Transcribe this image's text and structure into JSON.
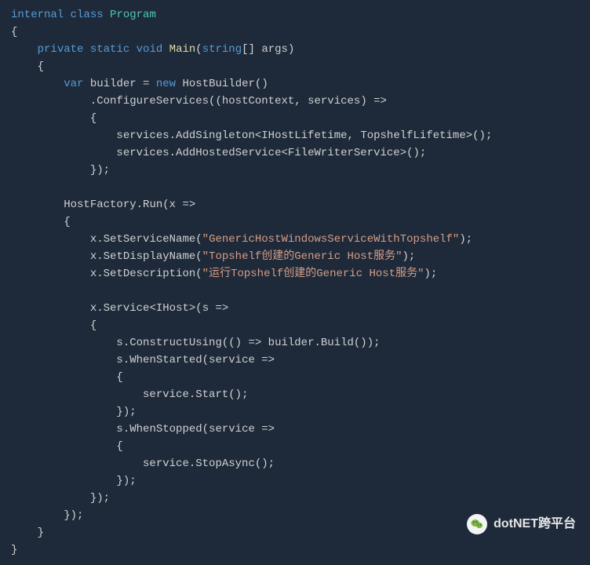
{
  "watermark": {
    "text": "dotNET跨平台"
  },
  "code": {
    "tokens": [
      [
        [
          "kw1",
          "internal"
        ],
        [
          "punc",
          " "
        ],
        [
          "kw1",
          "class"
        ],
        [
          "punc",
          " "
        ],
        [
          "kw2",
          "Program"
        ]
      ],
      [
        [
          "punc",
          "{"
        ]
      ],
      [
        [
          "punc",
          "    "
        ],
        [
          "kw1",
          "private"
        ],
        [
          "punc",
          " "
        ],
        [
          "kw1",
          "static"
        ],
        [
          "punc",
          " "
        ],
        [
          "kw1",
          "void"
        ],
        [
          "punc",
          " "
        ],
        [
          "mname",
          "Main"
        ],
        [
          "punc",
          "("
        ],
        [
          "kw1",
          "string"
        ],
        [
          "punc",
          "[] "
        ],
        [
          "ident",
          "args"
        ],
        [
          "punc",
          ")"
        ]
      ],
      [
        [
          "punc",
          "    {"
        ]
      ],
      [
        [
          "punc",
          "        "
        ],
        [
          "kw1",
          "var"
        ],
        [
          "punc",
          " "
        ],
        [
          "ident",
          "builder"
        ],
        [
          "punc",
          " = "
        ],
        [
          "kw1",
          "new"
        ],
        [
          "punc",
          " "
        ],
        [
          "ident",
          "HostBuilder"
        ],
        [
          "punc",
          "()"
        ]
      ],
      [
        [
          "punc",
          "            ."
        ],
        [
          "ident",
          "ConfigureServices"
        ],
        [
          "punc",
          "(("
        ],
        [
          "ident",
          "hostContext"
        ],
        [
          "punc",
          ", "
        ],
        [
          "ident",
          "services"
        ],
        [
          "punc",
          ") =>"
        ]
      ],
      [
        [
          "punc",
          "            {"
        ]
      ],
      [
        [
          "punc",
          "                "
        ],
        [
          "ident",
          "services"
        ],
        [
          "punc",
          "."
        ],
        [
          "ident",
          "AddSingleton"
        ],
        [
          "punc",
          "<"
        ],
        [
          "ident",
          "IHostLifetime"
        ],
        [
          "punc",
          ", "
        ],
        [
          "ident",
          "TopshelfLifetime"
        ],
        [
          "punc",
          ">();"
        ]
      ],
      [
        [
          "punc",
          "                "
        ],
        [
          "ident",
          "services"
        ],
        [
          "punc",
          "."
        ],
        [
          "ident",
          "AddHostedService"
        ],
        [
          "punc",
          "<"
        ],
        [
          "ident",
          "FileWriterService"
        ],
        [
          "punc",
          ">();"
        ]
      ],
      [
        [
          "punc",
          "            });"
        ]
      ],
      [
        [
          "punc",
          ""
        ]
      ],
      [
        [
          "punc",
          "        "
        ],
        [
          "ident",
          "HostFactory"
        ],
        [
          "punc",
          "."
        ],
        [
          "ident",
          "Run"
        ],
        [
          "punc",
          "("
        ],
        [
          "ident",
          "x"
        ],
        [
          "punc",
          " =>"
        ]
      ],
      [
        [
          "punc",
          "        {"
        ]
      ],
      [
        [
          "punc",
          "            "
        ],
        [
          "ident",
          "x"
        ],
        [
          "punc",
          "."
        ],
        [
          "ident",
          "SetServiceName"
        ],
        [
          "punc",
          "("
        ],
        [
          "str",
          "\"GenericHostWindowsServiceWithTopshelf\""
        ],
        [
          "punc",
          ");"
        ]
      ],
      [
        [
          "punc",
          "            "
        ],
        [
          "ident",
          "x"
        ],
        [
          "punc",
          "."
        ],
        [
          "ident",
          "SetDisplayName"
        ],
        [
          "punc",
          "("
        ],
        [
          "str",
          "\"Topshelf创建的Generic Host服务\""
        ],
        [
          "punc",
          ");"
        ]
      ],
      [
        [
          "punc",
          "            "
        ],
        [
          "ident",
          "x"
        ],
        [
          "punc",
          "."
        ],
        [
          "ident",
          "SetDescription"
        ],
        [
          "punc",
          "("
        ],
        [
          "str",
          "\"运行Topshelf创建的Generic Host服务\""
        ],
        [
          "punc",
          ");"
        ]
      ],
      [
        [
          "punc",
          ""
        ]
      ],
      [
        [
          "punc",
          "            "
        ],
        [
          "ident",
          "x"
        ],
        [
          "punc",
          "."
        ],
        [
          "ident",
          "Service"
        ],
        [
          "punc",
          "<"
        ],
        [
          "ident",
          "IHost"
        ],
        [
          "punc",
          ">("
        ],
        [
          "ident",
          "s"
        ],
        [
          "punc",
          " =>"
        ]
      ],
      [
        [
          "punc",
          "            {"
        ]
      ],
      [
        [
          "punc",
          "                "
        ],
        [
          "ident",
          "s"
        ],
        [
          "punc",
          "."
        ],
        [
          "ident",
          "ConstructUsing"
        ],
        [
          "punc",
          "(() => "
        ],
        [
          "ident",
          "builder"
        ],
        [
          "punc",
          "."
        ],
        [
          "ident",
          "Build"
        ],
        [
          "punc",
          "());"
        ]
      ],
      [
        [
          "punc",
          "                "
        ],
        [
          "ident",
          "s"
        ],
        [
          "punc",
          "."
        ],
        [
          "ident",
          "WhenStarted"
        ],
        [
          "punc",
          "("
        ],
        [
          "ident",
          "service"
        ],
        [
          "punc",
          " =>"
        ]
      ],
      [
        [
          "punc",
          "                {"
        ]
      ],
      [
        [
          "punc",
          "                    "
        ],
        [
          "ident",
          "service"
        ],
        [
          "punc",
          "."
        ],
        [
          "ident",
          "Start"
        ],
        [
          "punc",
          "();"
        ]
      ],
      [
        [
          "punc",
          "                });"
        ]
      ],
      [
        [
          "punc",
          "                "
        ],
        [
          "ident",
          "s"
        ],
        [
          "punc",
          "."
        ],
        [
          "ident",
          "WhenStopped"
        ],
        [
          "punc",
          "("
        ],
        [
          "ident",
          "service"
        ],
        [
          "punc",
          " =>"
        ]
      ],
      [
        [
          "punc",
          "                {"
        ]
      ],
      [
        [
          "punc",
          "                    "
        ],
        [
          "ident",
          "service"
        ],
        [
          "punc",
          "."
        ],
        [
          "ident",
          "StopAsync"
        ],
        [
          "punc",
          "();"
        ]
      ],
      [
        [
          "punc",
          "                });"
        ]
      ],
      [
        [
          "punc",
          "            });"
        ]
      ],
      [
        [
          "punc",
          "        });"
        ]
      ],
      [
        [
          "punc",
          "    }"
        ]
      ],
      [
        [
          "punc",
          "}"
        ]
      ]
    ]
  }
}
